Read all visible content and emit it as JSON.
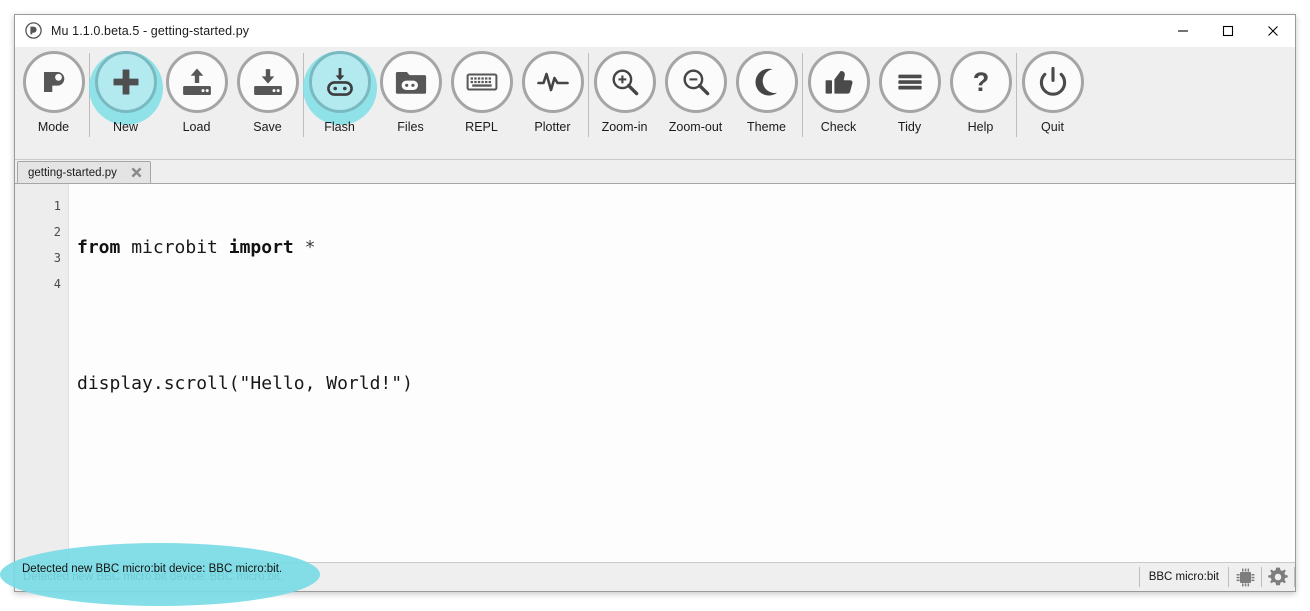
{
  "window": {
    "title": "Mu 1.1.0.beta.5 - getting-started.py",
    "logo_icon": "mu-logo-icon",
    "controls": [
      {
        "name": "minimize-button",
        "icon": "minimize-icon",
        "label": "—"
      },
      {
        "name": "maximize-button",
        "icon": "maximize-icon",
        "label": "□"
      },
      {
        "name": "close-button",
        "icon": "close-icon",
        "label": "✕"
      }
    ]
  },
  "toolbar": {
    "buttons": [
      {
        "label": "Mode",
        "icon": "mode-icon",
        "active": false
      },
      {
        "label": "New",
        "icon": "plus-icon",
        "active": true
      },
      {
        "label": "Load",
        "icon": "upload-icon",
        "active": false
      },
      {
        "label": "Save",
        "icon": "download-icon",
        "active": false
      },
      {
        "label": "Flash",
        "icon": "flash-microbit-icon",
        "active": true
      },
      {
        "label": "Files",
        "icon": "folder-microbit-icon",
        "active": false
      },
      {
        "label": "REPL",
        "icon": "keyboard-icon",
        "active": false
      },
      {
        "label": "Plotter",
        "icon": "waveform-icon",
        "active": false
      },
      {
        "label": "Zoom-in",
        "icon": "magnifier-plus-icon",
        "active": false
      },
      {
        "label": "Zoom-out",
        "icon": "magnifier-minus-icon",
        "active": false
      },
      {
        "label": "Theme",
        "icon": "moon-icon",
        "active": false
      },
      {
        "label": "Check",
        "icon": "thumbs-up-icon",
        "active": false
      },
      {
        "label": "Tidy",
        "icon": "bars-icon",
        "active": false
      },
      {
        "label": "Help",
        "icon": "question-mark-icon",
        "active": false
      },
      {
        "label": "Quit",
        "icon": "power-icon",
        "active": false
      }
    ],
    "separator_after": [
      "Mode",
      "Save",
      "Plotter",
      "Theme",
      "Help"
    ],
    "active_highlight_color": "#7fdfe8",
    "active_fill_color": "#b3eaf0"
  },
  "tabs": [
    {
      "title": "getting-started.py",
      "close_icon": "close-icon"
    }
  ],
  "editor": {
    "line_numbers": [
      "1",
      "2",
      "3",
      "4"
    ],
    "lines": [
      {
        "tokens": [
          {
            "text": "from",
            "style": "kw"
          },
          {
            "text": " microbit ",
            "style": "plain"
          },
          {
            "text": "import",
            "style": "kw"
          },
          {
            "text": " ",
            "style": "plain"
          },
          {
            "text": "*",
            "style": "op"
          }
        ]
      },
      {
        "tokens": []
      },
      {
        "tokens": [
          {
            "text": "display.scroll(\"Hello, World!\")",
            "style": "plain"
          }
        ]
      },
      {
        "tokens": []
      }
    ]
  },
  "statusbar": {
    "message": "Detected new BBC micro:bit device: BBC micro:bit.",
    "device": "BBC micro:bit",
    "icons": [
      {
        "name": "microchip-icon",
        "label": "microchip-icon"
      },
      {
        "name": "gear-icon",
        "label": "gear-icon"
      }
    ],
    "highlight_color": "#79dbe5"
  }
}
